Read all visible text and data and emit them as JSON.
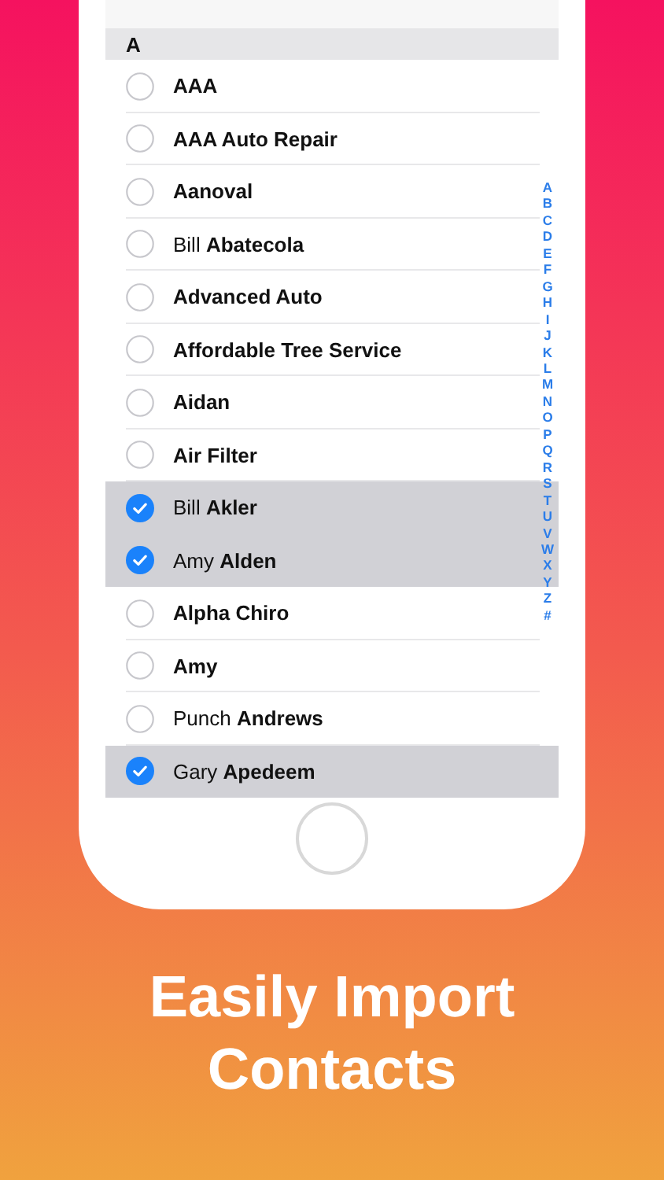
{
  "section": {
    "title": "A"
  },
  "contacts": [
    {
      "name": "AAA",
      "kind": "company",
      "selected": false
    },
    {
      "name": "AAA Auto Repair",
      "kind": "company",
      "selected": false
    },
    {
      "name": "Aanoval",
      "kind": "company",
      "selected": false
    },
    {
      "name": "Bill **Abatecola**",
      "kind": "person",
      "selected": false
    },
    {
      "name": "Advanced Auto",
      "kind": "company",
      "selected": false
    },
    {
      "name": "Affordable Tree Service",
      "kind": "company",
      "selected": false
    },
    {
      "name": "Aidan",
      "kind": "company",
      "selected": false
    },
    {
      "name": "Air Filter",
      "kind": "company",
      "selected": false
    },
    {
      "name": "Bill **Akler**",
      "kind": "person",
      "selected": true
    },
    {
      "name": "Amy **Alden**",
      "kind": "person",
      "selected": true
    },
    {
      "name": "Alpha Chiro",
      "kind": "company",
      "selected": false
    },
    {
      "name": "Amy",
      "kind": "company",
      "selected": false
    },
    {
      "name": "Punch **Andrews**",
      "kind": "person",
      "selected": false
    },
    {
      "name": "Gary **Apedeem**",
      "kind": "person",
      "selected": true
    }
  ],
  "index": [
    "A",
    "B",
    "C",
    "D",
    "E",
    "F",
    "G",
    "H",
    "I",
    "J",
    "K",
    "L",
    "M",
    "N",
    "O",
    "P",
    "Q",
    "R",
    "S",
    "T",
    "U",
    "V",
    "W",
    "X",
    "Y",
    "Z",
    "#"
  ],
  "headline": [
    "Easily Import",
    "Contacts"
  ]
}
